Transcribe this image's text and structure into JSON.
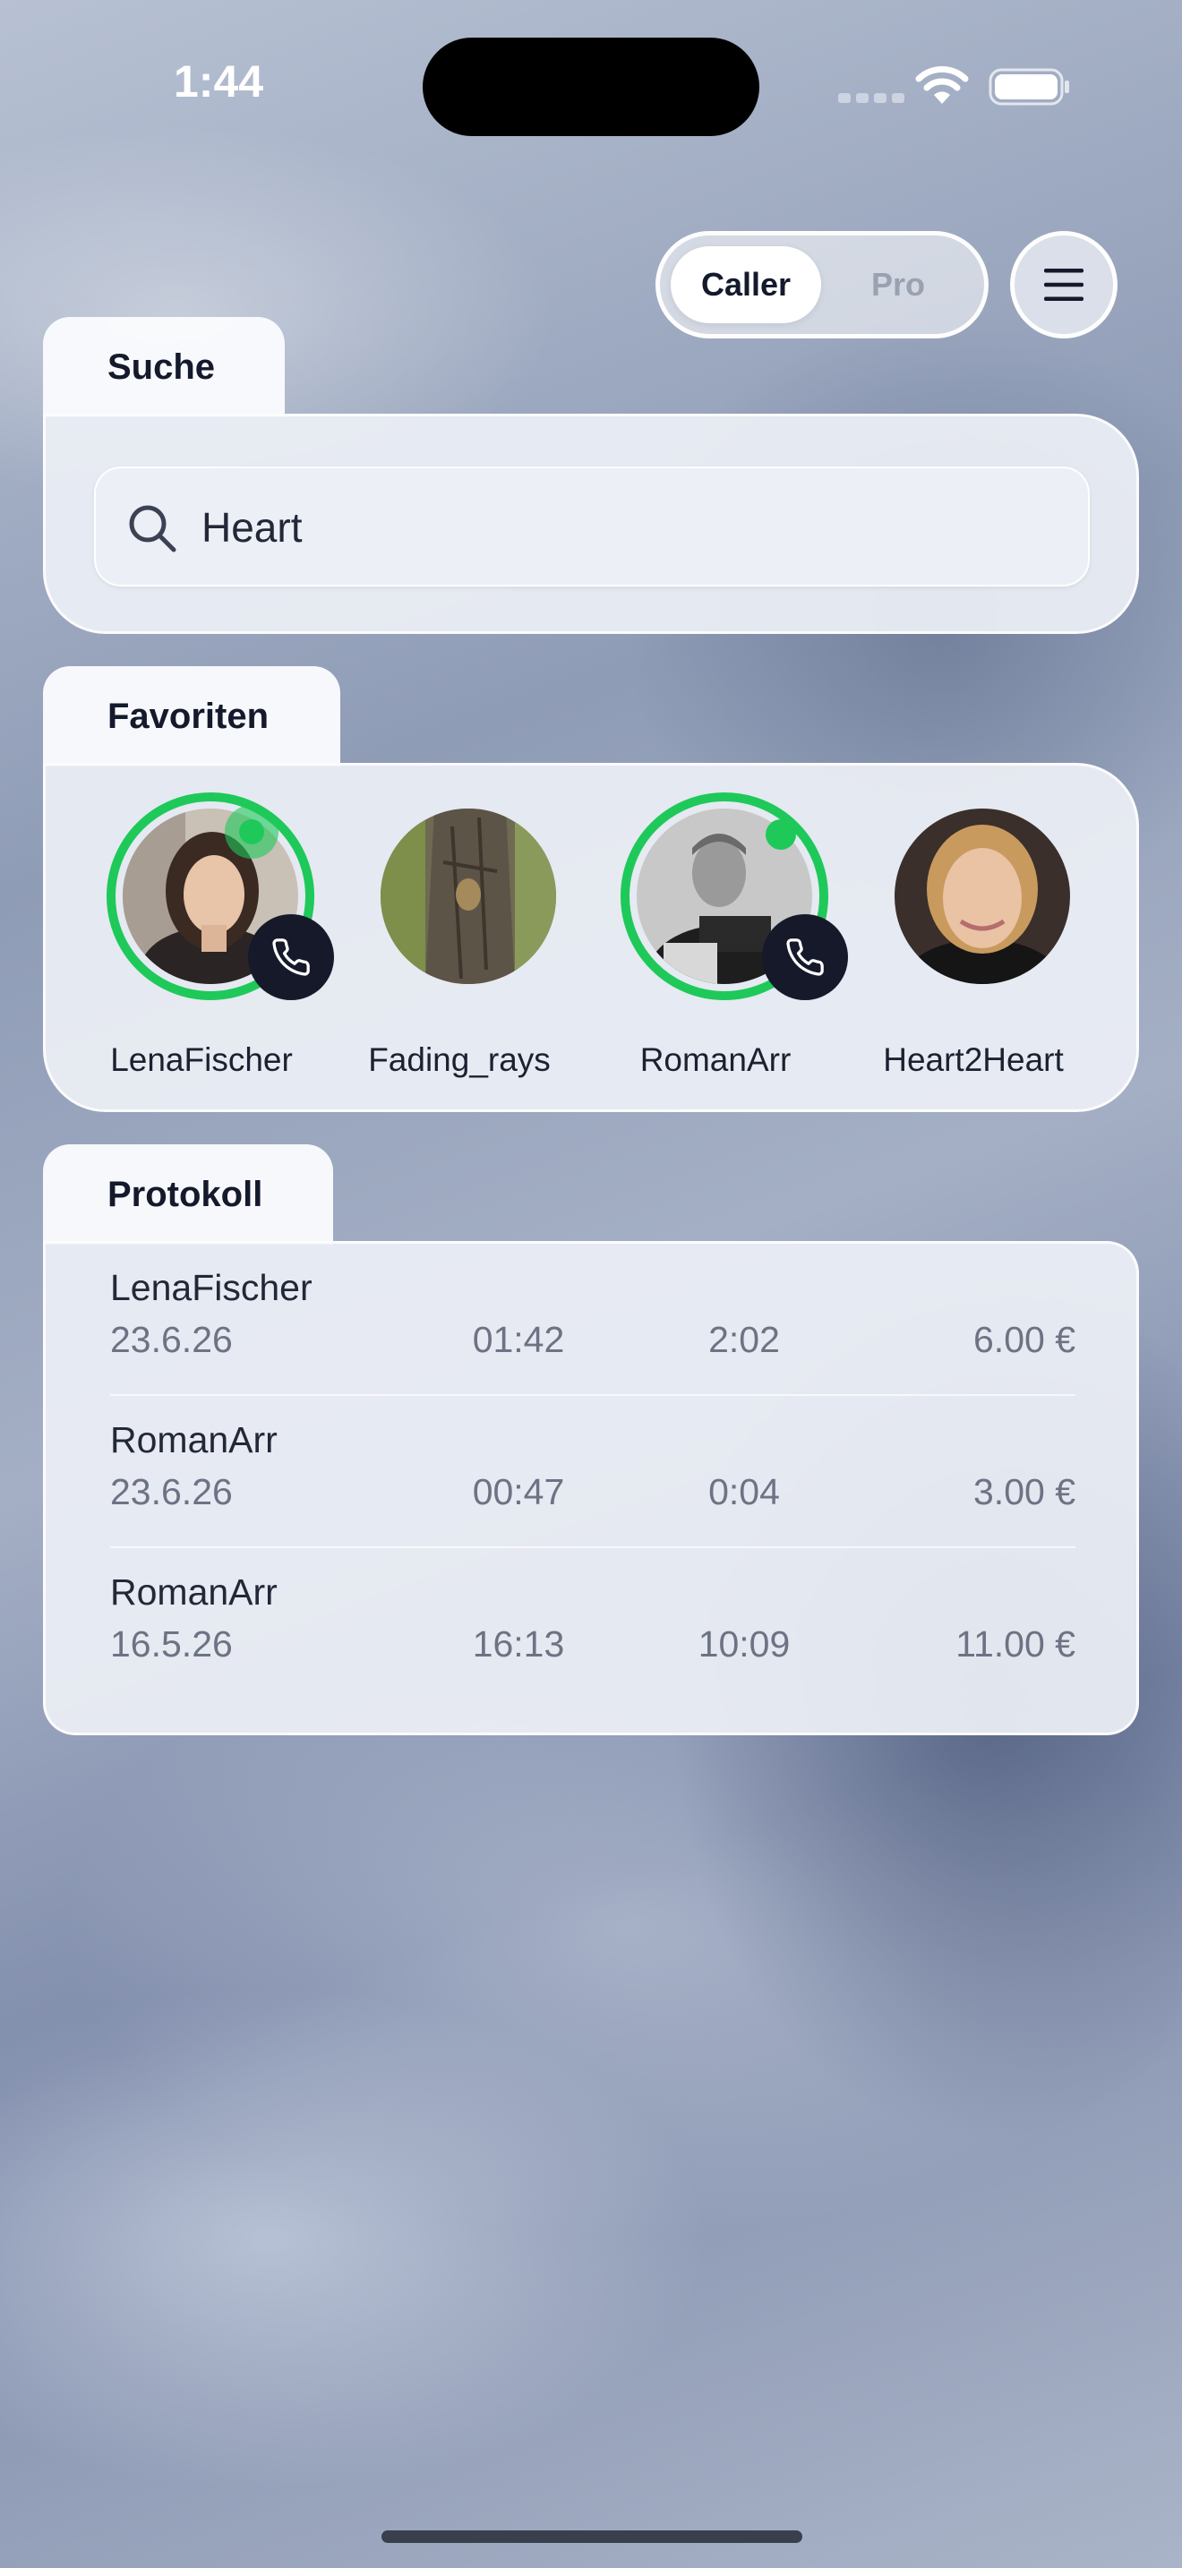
{
  "status_bar": {
    "time": "1:44"
  },
  "mode_toggle": {
    "caller_label": "Caller",
    "pro_label": "Pro",
    "selected": "Caller"
  },
  "search": {
    "tab_label": "Suche",
    "value": "Heart",
    "icon": "search-icon"
  },
  "favorites": {
    "tab_label": "Favoriten",
    "items": [
      {
        "name": "LenaFischer",
        "online": true,
        "callable": true,
        "status_color": "#1ec95a"
      },
      {
        "name": "Fading_rays",
        "online": false,
        "callable": false
      },
      {
        "name": "RomanArr",
        "online": true,
        "callable": true,
        "status_color": "#1ec95a"
      },
      {
        "name": "Heart2Heart",
        "online": false,
        "callable": false
      }
    ]
  },
  "log": {
    "tab_label": "Protokoll",
    "rows": [
      {
        "name": "LenaFischer",
        "date": "23.6.26",
        "time": "01:42",
        "duration": "2:02",
        "price": "6.00 €"
      },
      {
        "name": "RomanArr",
        "date": "23.6.26",
        "time": "00:47",
        "duration": "0:04",
        "price": "3.00 €"
      },
      {
        "name": "RomanArr",
        "date": "16.5.26",
        "time": "16:13",
        "duration": "10:09",
        "price": "11.00 €"
      }
    ]
  },
  "colors": {
    "accent_online": "#1ec95a",
    "dark": "#16192a"
  }
}
